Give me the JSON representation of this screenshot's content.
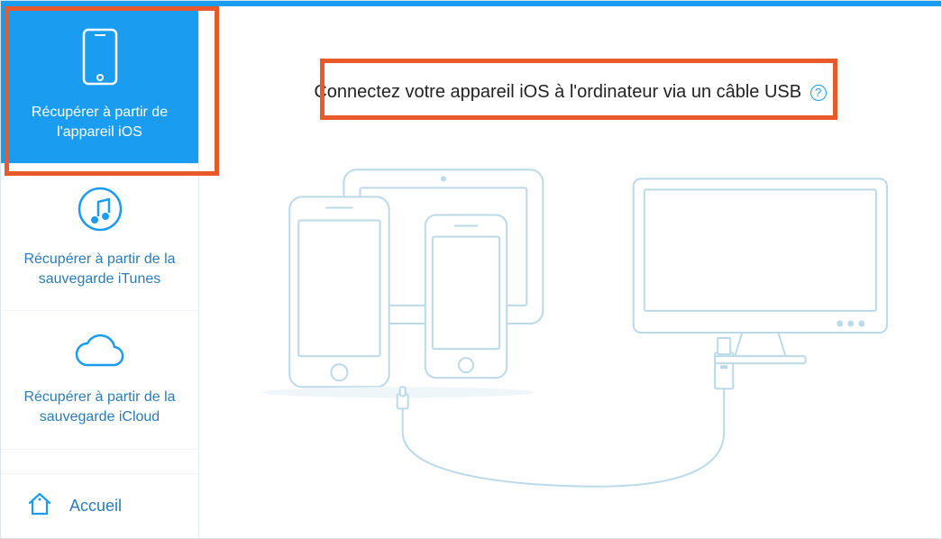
{
  "sidebar": {
    "items": [
      {
        "label": "Récupérer à partir de l'appareil iOS"
      },
      {
        "label": "Récupérer à partir de la sauvegarde iTunes"
      },
      {
        "label": "Récupérer à partir de la sauvegarde iCloud"
      }
    ],
    "footer": {
      "label": "Accueil"
    }
  },
  "main": {
    "instruction": "Connectez votre appareil iOS à l'ordinateur via un câble USB",
    "help_symbol": "?"
  },
  "colors": {
    "accent": "#1a9cf0",
    "highlight": "#e85a2b",
    "sidebar_text": "#2d7bb5"
  }
}
